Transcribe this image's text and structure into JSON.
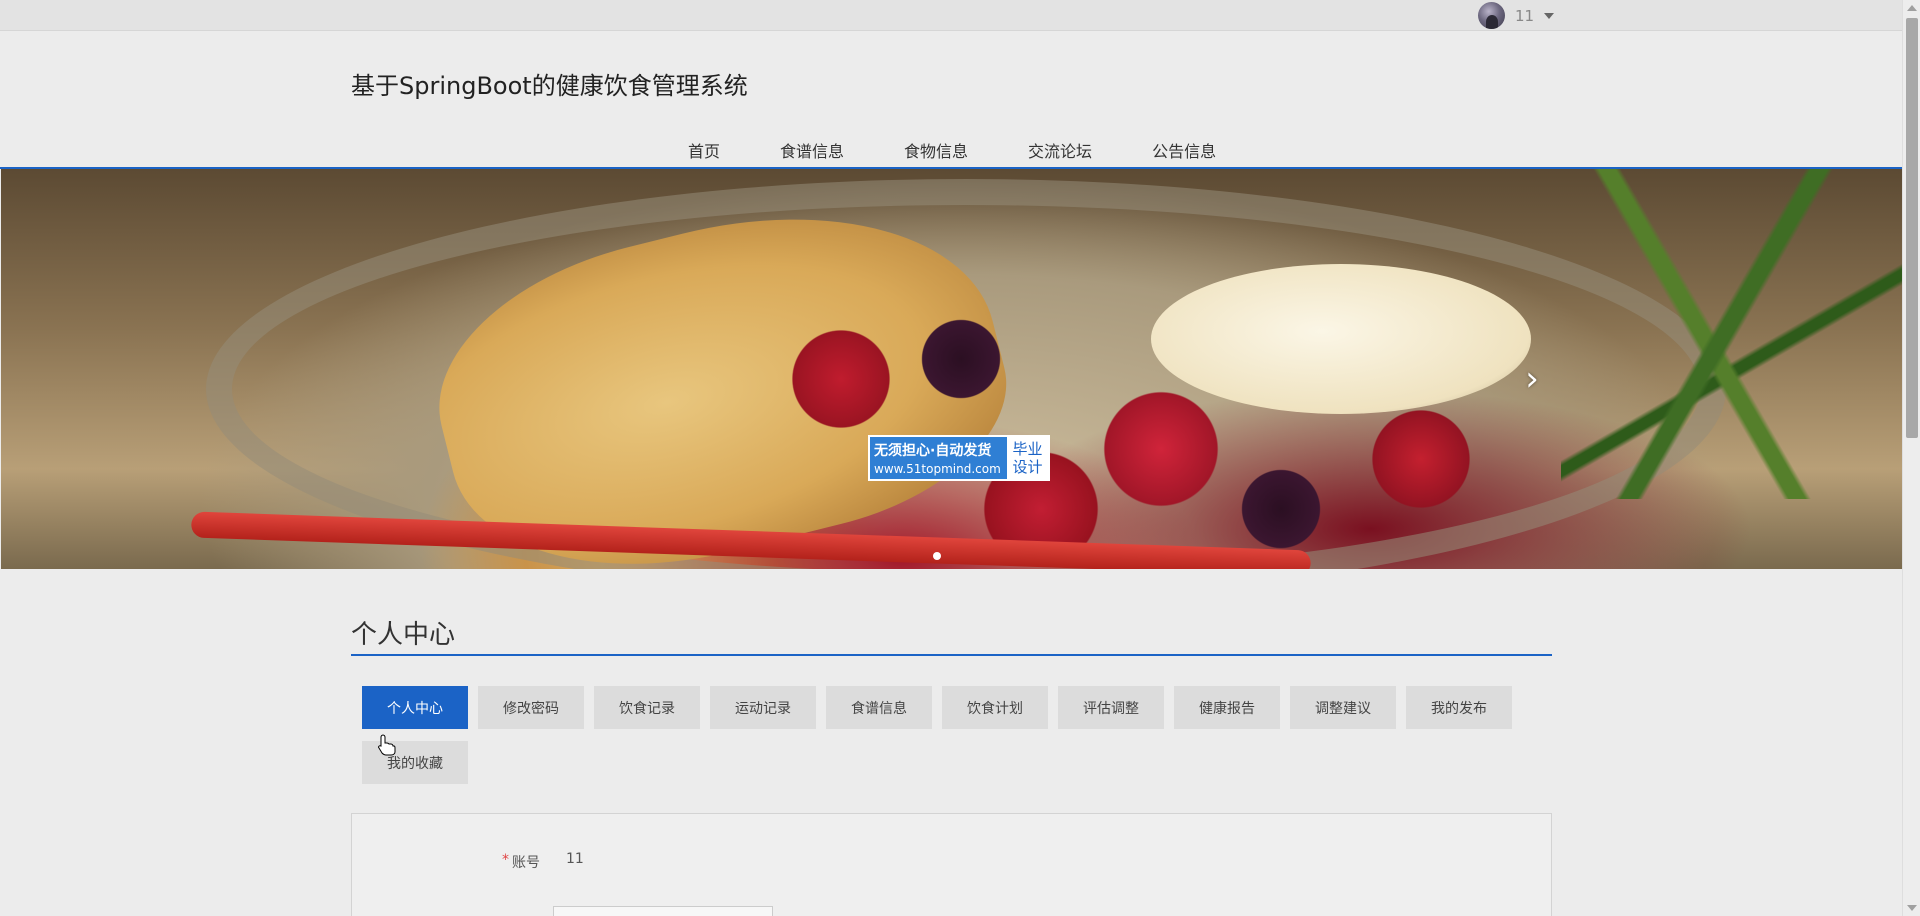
{
  "user": {
    "name": "11"
  },
  "header": {
    "title": "基于SpringBoot的健康饮食管理系统"
  },
  "nav": [
    "首页",
    "食谱信息",
    "食物信息",
    "交流论坛",
    "公告信息"
  ],
  "banner": {
    "watermark": {
      "line1": "无须担心·自动发货",
      "line2": "www.51topmind.com",
      "tag": "毕业设计"
    }
  },
  "section": {
    "title": "个人中心",
    "tabs": [
      "个人中心",
      "修改密码",
      "饮食记录",
      "运动记录",
      "食谱信息",
      "饮食计划",
      "评估调整",
      "健康报告",
      "调整建议",
      "我的发布",
      "我的收藏"
    ],
    "active_tab": "个人中心"
  },
  "form": {
    "account_label": "账号",
    "account_value": "11",
    "required_mark": "*"
  }
}
